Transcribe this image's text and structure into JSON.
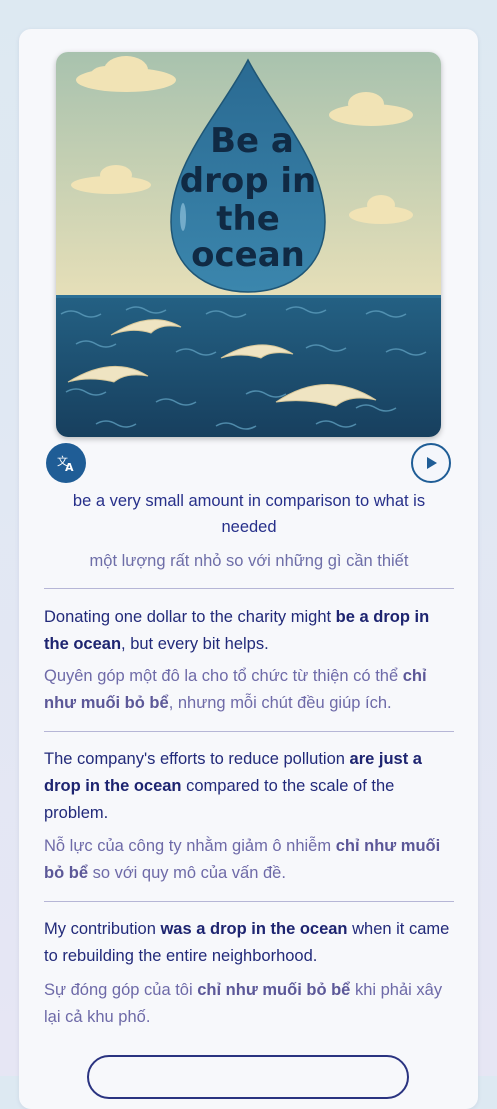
{
  "illustration": {
    "text_lines": [
      "Be a",
      "drop in",
      "the",
      "ocean"
    ],
    "colors": {
      "sky": "#cfd7b6",
      "water": "#1f5676",
      "drop": "#2e7299",
      "text": "#0f2a44"
    }
  },
  "controls": {
    "translate_icon": "translate-icon",
    "play_icon": "play-icon",
    "accent": "#1f5d96"
  },
  "definition": {
    "en": "be a very small amount in comparison to what is needed",
    "vi": "một lượng rất nhỏ so với những gì cần thiết"
  },
  "examples": [
    {
      "en_before": "Donating one dollar to the charity might ",
      "en_bold": "be a drop in the ocean",
      "en_after": ", but every bit helps.",
      "vi_before": "Quyên góp một đô la cho tổ chức từ thiện có thể ",
      "vi_bold": "chỉ như muối bỏ bể",
      "vi_after": ", nhưng mỗi chút đều giúp ích."
    },
    {
      "en_before": "The company's efforts to reduce pollution ",
      "en_bold": "are just a drop in the ocean",
      "en_after": " compared to the scale of the problem.",
      "vi_before": "Nỗ lực của công ty nhằm giảm ô nhiễm ",
      "vi_bold": "chỉ như muối bỏ bể",
      "vi_after": " so với quy mô của vấn đề."
    },
    {
      "en_before": "My contribution ",
      "en_bold": "was a drop in the ocean",
      "en_after": " when it came to rebuilding the entire neighborhood.",
      "vi_before": "Sự đóng góp của tôi ",
      "vi_bold": "chỉ như muối bỏ bể",
      "vi_after": " khi phải xây lại cả khu phố."
    }
  ]
}
